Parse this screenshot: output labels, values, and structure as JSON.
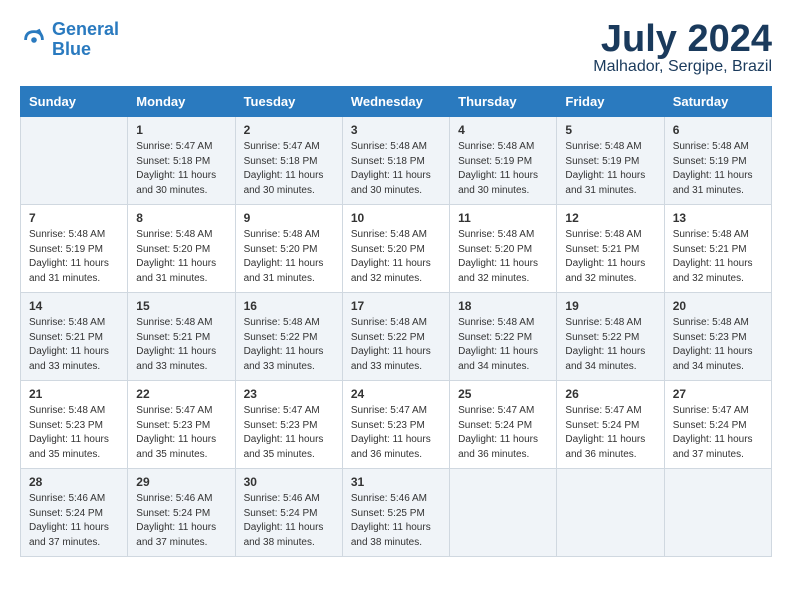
{
  "header": {
    "logo_line1": "General",
    "logo_line2": "Blue",
    "month": "July 2024",
    "location": "Malhador, Sergipe, Brazil"
  },
  "days_of_week": [
    "Sunday",
    "Monday",
    "Tuesday",
    "Wednesday",
    "Thursday",
    "Friday",
    "Saturday"
  ],
  "weeks": [
    [
      {
        "day": "",
        "info": ""
      },
      {
        "day": "1",
        "info": "Sunrise: 5:47 AM\nSunset: 5:18 PM\nDaylight: 11 hours\nand 30 minutes."
      },
      {
        "day": "2",
        "info": "Sunrise: 5:47 AM\nSunset: 5:18 PM\nDaylight: 11 hours\nand 30 minutes."
      },
      {
        "day": "3",
        "info": "Sunrise: 5:48 AM\nSunset: 5:18 PM\nDaylight: 11 hours\nand 30 minutes."
      },
      {
        "day": "4",
        "info": "Sunrise: 5:48 AM\nSunset: 5:19 PM\nDaylight: 11 hours\nand 30 minutes."
      },
      {
        "day": "5",
        "info": "Sunrise: 5:48 AM\nSunset: 5:19 PM\nDaylight: 11 hours\nand 31 minutes."
      },
      {
        "day": "6",
        "info": "Sunrise: 5:48 AM\nSunset: 5:19 PM\nDaylight: 11 hours\nand 31 minutes."
      }
    ],
    [
      {
        "day": "7",
        "info": "Sunrise: 5:48 AM\nSunset: 5:19 PM\nDaylight: 11 hours\nand 31 minutes."
      },
      {
        "day": "8",
        "info": "Sunrise: 5:48 AM\nSunset: 5:20 PM\nDaylight: 11 hours\nand 31 minutes."
      },
      {
        "day": "9",
        "info": "Sunrise: 5:48 AM\nSunset: 5:20 PM\nDaylight: 11 hours\nand 31 minutes."
      },
      {
        "day": "10",
        "info": "Sunrise: 5:48 AM\nSunset: 5:20 PM\nDaylight: 11 hours\nand 32 minutes."
      },
      {
        "day": "11",
        "info": "Sunrise: 5:48 AM\nSunset: 5:20 PM\nDaylight: 11 hours\nand 32 minutes."
      },
      {
        "day": "12",
        "info": "Sunrise: 5:48 AM\nSunset: 5:21 PM\nDaylight: 11 hours\nand 32 minutes."
      },
      {
        "day": "13",
        "info": "Sunrise: 5:48 AM\nSunset: 5:21 PM\nDaylight: 11 hours\nand 32 minutes."
      }
    ],
    [
      {
        "day": "14",
        "info": "Sunrise: 5:48 AM\nSunset: 5:21 PM\nDaylight: 11 hours\nand 33 minutes."
      },
      {
        "day": "15",
        "info": "Sunrise: 5:48 AM\nSunset: 5:21 PM\nDaylight: 11 hours\nand 33 minutes."
      },
      {
        "day": "16",
        "info": "Sunrise: 5:48 AM\nSunset: 5:22 PM\nDaylight: 11 hours\nand 33 minutes."
      },
      {
        "day": "17",
        "info": "Sunrise: 5:48 AM\nSunset: 5:22 PM\nDaylight: 11 hours\nand 33 minutes."
      },
      {
        "day": "18",
        "info": "Sunrise: 5:48 AM\nSunset: 5:22 PM\nDaylight: 11 hours\nand 34 minutes."
      },
      {
        "day": "19",
        "info": "Sunrise: 5:48 AM\nSunset: 5:22 PM\nDaylight: 11 hours\nand 34 minutes."
      },
      {
        "day": "20",
        "info": "Sunrise: 5:48 AM\nSunset: 5:23 PM\nDaylight: 11 hours\nand 34 minutes."
      }
    ],
    [
      {
        "day": "21",
        "info": "Sunrise: 5:48 AM\nSunset: 5:23 PM\nDaylight: 11 hours\nand 35 minutes."
      },
      {
        "day": "22",
        "info": "Sunrise: 5:47 AM\nSunset: 5:23 PM\nDaylight: 11 hours\nand 35 minutes."
      },
      {
        "day": "23",
        "info": "Sunrise: 5:47 AM\nSunset: 5:23 PM\nDaylight: 11 hours\nand 35 minutes."
      },
      {
        "day": "24",
        "info": "Sunrise: 5:47 AM\nSunset: 5:23 PM\nDaylight: 11 hours\nand 36 minutes."
      },
      {
        "day": "25",
        "info": "Sunrise: 5:47 AM\nSunset: 5:24 PM\nDaylight: 11 hours\nand 36 minutes."
      },
      {
        "day": "26",
        "info": "Sunrise: 5:47 AM\nSunset: 5:24 PM\nDaylight: 11 hours\nand 36 minutes."
      },
      {
        "day": "27",
        "info": "Sunrise: 5:47 AM\nSunset: 5:24 PM\nDaylight: 11 hours\nand 37 minutes."
      }
    ],
    [
      {
        "day": "28",
        "info": "Sunrise: 5:46 AM\nSunset: 5:24 PM\nDaylight: 11 hours\nand 37 minutes."
      },
      {
        "day": "29",
        "info": "Sunrise: 5:46 AM\nSunset: 5:24 PM\nDaylight: 11 hours\nand 37 minutes."
      },
      {
        "day": "30",
        "info": "Sunrise: 5:46 AM\nSunset: 5:24 PM\nDaylight: 11 hours\nand 38 minutes."
      },
      {
        "day": "31",
        "info": "Sunrise: 5:46 AM\nSunset: 5:25 PM\nDaylight: 11 hours\nand 38 minutes."
      },
      {
        "day": "",
        "info": ""
      },
      {
        "day": "",
        "info": ""
      },
      {
        "day": "",
        "info": ""
      }
    ]
  ]
}
